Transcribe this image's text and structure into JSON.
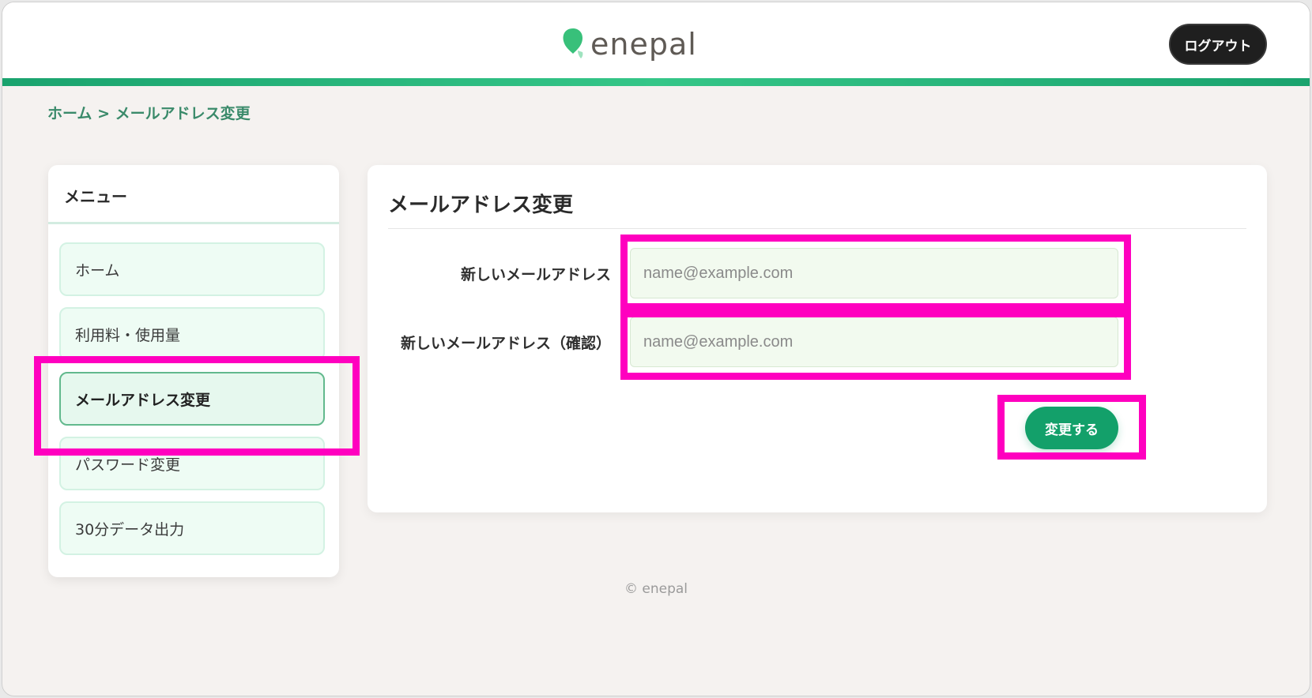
{
  "header": {
    "logo_text": "enepal",
    "logout_label": "ログアウト"
  },
  "breadcrumb": {
    "home": "ホーム",
    "separator": ">",
    "current": "メールアドレス変更"
  },
  "sidebar": {
    "title": "メニュー",
    "items": [
      {
        "label": "ホーム",
        "active": false
      },
      {
        "label": "利用料・使用量",
        "active": false
      },
      {
        "label": "メールアドレス変更",
        "active": true
      },
      {
        "label": "パスワード変更",
        "active": false
      },
      {
        "label": "30分データ出力",
        "active": false
      }
    ]
  },
  "main": {
    "title": "メールアドレス変更",
    "fields": [
      {
        "label": "新しいメールアドレス",
        "placeholder": "name@example.com",
        "value": ""
      },
      {
        "label": "新しいメールアドレス（確認）",
        "placeholder": "name@example.com",
        "value": ""
      }
    ],
    "submit_label": "変更する"
  },
  "footer": {
    "copyright": "© enepal"
  },
  "colors": {
    "brand_green": "#13a06a",
    "highlight_magenta": "#ff00bf",
    "logout_bg": "#1f1f1f"
  }
}
